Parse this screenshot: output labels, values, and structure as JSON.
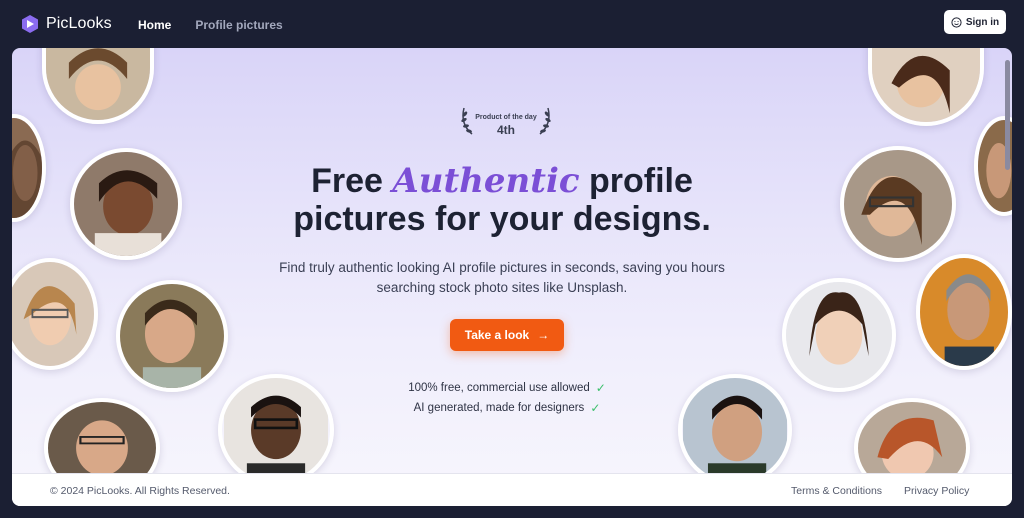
{
  "header": {
    "brand": "PicLooks",
    "nav": [
      {
        "label": "Home"
      },
      {
        "label": "Profile pictures"
      }
    ],
    "signin_label": "Sign in"
  },
  "hero": {
    "badge_top": "Product of the day",
    "badge_rank": "4th",
    "headline_before": "Free ",
    "headline_accent": "Authentic",
    "headline_after": " profile pictures for your designs.",
    "subtext": "Find truly authentic looking AI profile pictures in seconds, saving you hours searching stock photo sites like Unsplash.",
    "cta_label": "Take a look",
    "features": [
      "100% free, commercial use allowed",
      "AI generated, made for designers"
    ]
  },
  "footer": {
    "copyright": "© 2024 PicLooks. All Rights Reserved.",
    "terms": "Terms & Conditions",
    "privacy": "Privacy Policy"
  },
  "colors": {
    "accent": "#7b4fd6",
    "cta": "#f15a12",
    "check": "#3bbf6a",
    "topbar": "#1b1f33"
  }
}
